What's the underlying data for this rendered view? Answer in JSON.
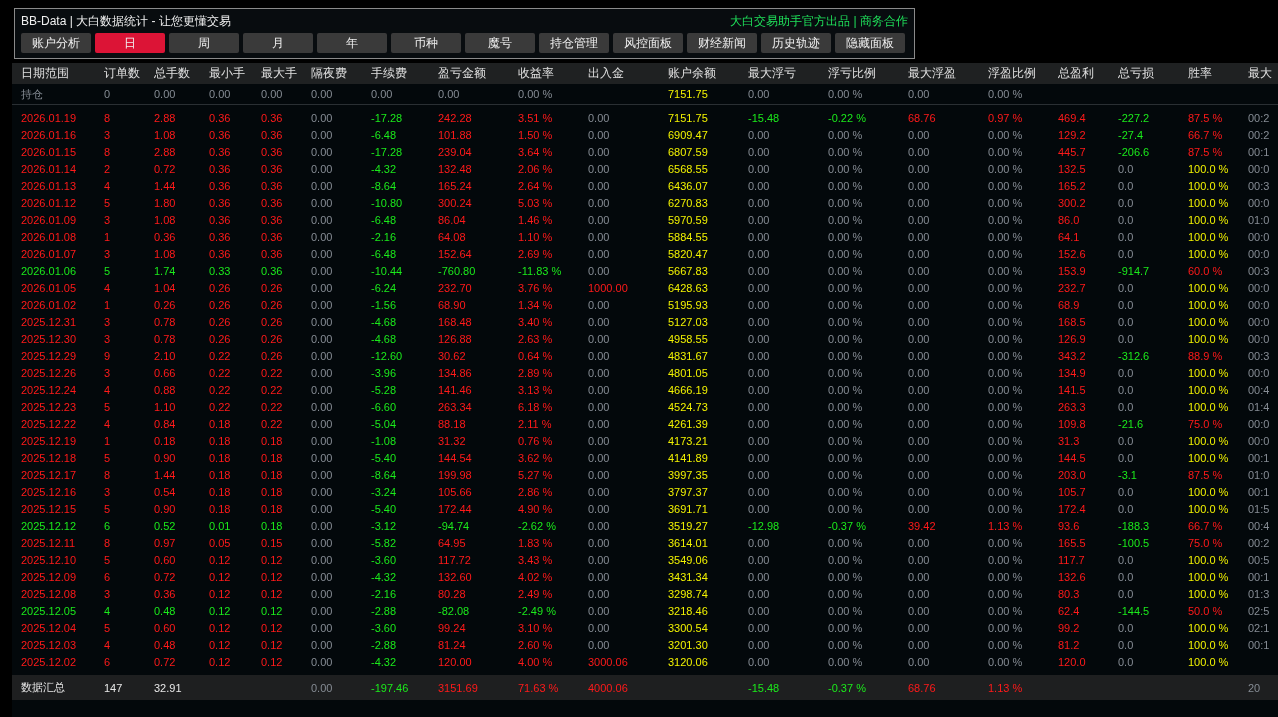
{
  "panel": {
    "title": "BB-Data | 大白数据统计 - 让您更懂交易",
    "credit": "大白交易助手官方出品 | 商务合作"
  },
  "buttons": [
    {
      "label": "账户分析",
      "selected": false
    },
    {
      "label": "日",
      "selected": true
    },
    {
      "label": "周",
      "selected": false
    },
    {
      "label": "月",
      "selected": false
    },
    {
      "label": "年",
      "selected": false
    },
    {
      "label": "币种",
      "selected": false
    },
    {
      "label": "魔号",
      "selected": false
    },
    {
      "label": "持仓管理",
      "selected": false
    },
    {
      "label": "风控面板",
      "selected": false
    },
    {
      "label": "财经新闻",
      "selected": false
    },
    {
      "label": "历史轨迹",
      "selected": false
    },
    {
      "label": "隐藏面板",
      "selected": false
    }
  ],
  "table": {
    "columns": [
      "日期范围",
      "订单数",
      "总手数",
      "最小手",
      "最大手",
      "隔夜费",
      "手续费",
      "盈亏金额",
      "收益率",
      "出入金",
      "账户余额",
      "最大浮亏",
      "浮亏比例",
      "最大浮盈",
      "浮盈比例",
      "总盈利",
      "总亏损",
      "胜率",
      "最大"
    ],
    "hold_row": {
      "cells": [
        "持仓",
        "0",
        "0.00",
        "0.00",
        "0.00",
        "0.00",
        "0.00",
        "0.00",
        "0.00 %",
        null,
        "7151.75",
        "0.00",
        "0.00 %",
        "0.00",
        "0.00 %",
        null,
        null,
        null,
        null
      ]
    },
    "rows": [
      {
        "loss": false,
        "deposit": false,
        "floating": true,
        "had_loss": true,
        "all_won": false,
        "cells": [
          "2026.01.19",
          "8",
          "2.88",
          "0.36",
          "0.36",
          "0.00",
          "-17.28",
          "242.28",
          "3.51 %",
          "0.00",
          "7151.75",
          "-15.48",
          "-0.22 %",
          "68.76",
          "0.97 %",
          "469.4",
          "-227.2",
          "87.5 %",
          "00:2"
        ]
      },
      {
        "loss": false,
        "deposit": false,
        "floating": false,
        "had_loss": true,
        "all_won": false,
        "cells": [
          "2026.01.16",
          "3",
          "1.08",
          "0.36",
          "0.36",
          "0.00",
          "-6.48",
          "101.88",
          "1.50 %",
          "0.00",
          "6909.47",
          "0.00",
          "0.00 %",
          "0.00",
          "0.00 %",
          "129.2",
          "-27.4",
          "66.7 %",
          "00:2"
        ]
      },
      {
        "loss": false,
        "deposit": false,
        "floating": false,
        "had_loss": true,
        "all_won": false,
        "cells": [
          "2026.01.15",
          "8",
          "2.88",
          "0.36",
          "0.36",
          "0.00",
          "-17.28",
          "239.04",
          "3.64 %",
          "0.00",
          "6807.59",
          "0.00",
          "0.00 %",
          "0.00",
          "0.00 %",
          "445.7",
          "-206.6",
          "87.5 %",
          "00:1"
        ]
      },
      {
        "loss": false,
        "deposit": false,
        "floating": false,
        "had_loss": false,
        "all_won": true,
        "cells": [
          "2026.01.14",
          "2",
          "0.72",
          "0.36",
          "0.36",
          "0.00",
          "-4.32",
          "132.48",
          "2.06 %",
          "0.00",
          "6568.55",
          "0.00",
          "0.00 %",
          "0.00",
          "0.00 %",
          "132.5",
          "0.0",
          "100.0 %",
          "00:0"
        ]
      },
      {
        "loss": false,
        "deposit": false,
        "floating": false,
        "had_loss": false,
        "all_won": true,
        "cells": [
          "2026.01.13",
          "4",
          "1.44",
          "0.36",
          "0.36",
          "0.00",
          "-8.64",
          "165.24",
          "2.64 %",
          "0.00",
          "6436.07",
          "0.00",
          "0.00 %",
          "0.00",
          "0.00 %",
          "165.2",
          "0.0",
          "100.0 %",
          "00:3"
        ]
      },
      {
        "loss": false,
        "deposit": false,
        "floating": false,
        "had_loss": false,
        "all_won": true,
        "cells": [
          "2026.01.12",
          "5",
          "1.80",
          "0.36",
          "0.36",
          "0.00",
          "-10.80",
          "300.24",
          "5.03 %",
          "0.00",
          "6270.83",
          "0.00",
          "0.00 %",
          "0.00",
          "0.00 %",
          "300.2",
          "0.0",
          "100.0 %",
          "00:0"
        ]
      },
      {
        "loss": false,
        "deposit": false,
        "floating": false,
        "had_loss": false,
        "all_won": true,
        "cells": [
          "2026.01.09",
          "3",
          "1.08",
          "0.36",
          "0.36",
          "0.00",
          "-6.48",
          "86.04",
          "1.46 %",
          "0.00",
          "5970.59",
          "0.00",
          "0.00 %",
          "0.00",
          "0.00 %",
          "86.0",
          "0.0",
          "100.0 %",
          "01:0"
        ]
      },
      {
        "loss": false,
        "deposit": false,
        "floating": false,
        "had_loss": false,
        "all_won": true,
        "cells": [
          "2026.01.08",
          "1",
          "0.36",
          "0.36",
          "0.36",
          "0.00",
          "-2.16",
          "64.08",
          "1.10 %",
          "0.00",
          "5884.55",
          "0.00",
          "0.00 %",
          "0.00",
          "0.00 %",
          "64.1",
          "0.0",
          "100.0 %",
          "00:0"
        ]
      },
      {
        "loss": false,
        "deposit": false,
        "floating": false,
        "had_loss": false,
        "all_won": true,
        "cells": [
          "2026.01.07",
          "3",
          "1.08",
          "0.36",
          "0.36",
          "0.00",
          "-6.48",
          "152.64",
          "2.69 %",
          "0.00",
          "5820.47",
          "0.00",
          "0.00 %",
          "0.00",
          "0.00 %",
          "152.6",
          "0.0",
          "100.0 %",
          "00:0"
        ]
      },
      {
        "loss": true,
        "deposit": false,
        "floating": false,
        "had_loss": true,
        "all_won": false,
        "cells": [
          "2026.01.06",
          "5",
          "1.74",
          "0.33",
          "0.36",
          "0.00",
          "-10.44",
          "-760.80",
          "-11.83 %",
          "0.00",
          "5667.83",
          "0.00",
          "0.00 %",
          "0.00",
          "0.00 %",
          "153.9",
          "-914.7",
          "60.0 %",
          "00:3"
        ]
      },
      {
        "loss": false,
        "deposit": true,
        "floating": false,
        "had_loss": false,
        "all_won": true,
        "cells": [
          "2026.01.05",
          "4",
          "1.04",
          "0.26",
          "0.26",
          "0.00",
          "-6.24",
          "232.70",
          "3.76 %",
          "1000.00",
          "6428.63",
          "0.00",
          "0.00 %",
          "0.00",
          "0.00 %",
          "232.7",
          "0.0",
          "100.0 %",
          "00:0"
        ]
      },
      {
        "loss": false,
        "deposit": false,
        "floating": false,
        "had_loss": false,
        "all_won": true,
        "cells": [
          "2026.01.02",
          "1",
          "0.26",
          "0.26",
          "0.26",
          "0.00",
          "-1.56",
          "68.90",
          "1.34 %",
          "0.00",
          "5195.93",
          "0.00",
          "0.00 %",
          "0.00",
          "0.00 %",
          "68.9",
          "0.0",
          "100.0 %",
          "00:0"
        ]
      },
      {
        "loss": false,
        "deposit": false,
        "floating": false,
        "had_loss": false,
        "all_won": true,
        "cells": [
          "2025.12.31",
          "3",
          "0.78",
          "0.26",
          "0.26",
          "0.00",
          "-4.68",
          "168.48",
          "3.40 %",
          "0.00",
          "5127.03",
          "0.00",
          "0.00 %",
          "0.00",
          "0.00 %",
          "168.5",
          "0.0",
          "100.0 %",
          "00:0"
        ]
      },
      {
        "loss": false,
        "deposit": false,
        "floating": false,
        "had_loss": false,
        "all_won": true,
        "cells": [
          "2025.12.30",
          "3",
          "0.78",
          "0.26",
          "0.26",
          "0.00",
          "-4.68",
          "126.88",
          "2.63 %",
          "0.00",
          "4958.55",
          "0.00",
          "0.00 %",
          "0.00",
          "0.00 %",
          "126.9",
          "0.0",
          "100.0 %",
          "00:0"
        ]
      },
      {
        "loss": false,
        "deposit": false,
        "floating": false,
        "had_loss": true,
        "all_won": false,
        "cells": [
          "2025.12.29",
          "9",
          "2.10",
          "0.22",
          "0.26",
          "0.00",
          "-12.60",
          "30.62",
          "0.64 %",
          "0.00",
          "4831.67",
          "0.00",
          "0.00 %",
          "0.00",
          "0.00 %",
          "343.2",
          "-312.6",
          "88.9 %",
          "00:3"
        ]
      },
      {
        "loss": false,
        "deposit": false,
        "floating": false,
        "had_loss": false,
        "all_won": true,
        "cells": [
          "2025.12.26",
          "3",
          "0.66",
          "0.22",
          "0.22",
          "0.00",
          "-3.96",
          "134.86",
          "2.89 %",
          "0.00",
          "4801.05",
          "0.00",
          "0.00 %",
          "0.00",
          "0.00 %",
          "134.9",
          "0.0",
          "100.0 %",
          "00:0"
        ]
      },
      {
        "loss": false,
        "deposit": false,
        "floating": false,
        "had_loss": false,
        "all_won": true,
        "cells": [
          "2025.12.24",
          "4",
          "0.88",
          "0.22",
          "0.22",
          "0.00",
          "-5.28",
          "141.46",
          "3.13 %",
          "0.00",
          "4666.19",
          "0.00",
          "0.00 %",
          "0.00",
          "0.00 %",
          "141.5",
          "0.0",
          "100.0 %",
          "00:4"
        ]
      },
      {
        "loss": false,
        "deposit": false,
        "floating": false,
        "had_loss": false,
        "all_won": true,
        "cells": [
          "2025.12.23",
          "5",
          "1.10",
          "0.22",
          "0.22",
          "0.00",
          "-6.60",
          "263.34",
          "6.18 %",
          "0.00",
          "4524.73",
          "0.00",
          "0.00 %",
          "0.00",
          "0.00 %",
          "263.3",
          "0.0",
          "100.0 %",
          "01:4"
        ]
      },
      {
        "loss": false,
        "deposit": false,
        "floating": false,
        "had_loss": true,
        "all_won": false,
        "cells": [
          "2025.12.22",
          "4",
          "0.84",
          "0.18",
          "0.22",
          "0.00",
          "-5.04",
          "88.18",
          "2.11 %",
          "0.00",
          "4261.39",
          "0.00",
          "0.00 %",
          "0.00",
          "0.00 %",
          "109.8",
          "-21.6",
          "75.0 %",
          "00:0"
        ]
      },
      {
        "loss": false,
        "deposit": false,
        "floating": false,
        "had_loss": false,
        "all_won": true,
        "cells": [
          "2025.12.19",
          "1",
          "0.18",
          "0.18",
          "0.18",
          "0.00",
          "-1.08",
          "31.32",
          "0.76 %",
          "0.00",
          "4173.21",
          "0.00",
          "0.00 %",
          "0.00",
          "0.00 %",
          "31.3",
          "0.0",
          "100.0 %",
          "00:0"
        ]
      },
      {
        "loss": false,
        "deposit": false,
        "floating": false,
        "had_loss": false,
        "all_won": true,
        "cells": [
          "2025.12.18",
          "5",
          "0.90",
          "0.18",
          "0.18",
          "0.00",
          "-5.40",
          "144.54",
          "3.62 %",
          "0.00",
          "4141.89",
          "0.00",
          "0.00 %",
          "0.00",
          "0.00 %",
          "144.5",
          "0.0",
          "100.0 %",
          "00:1"
        ]
      },
      {
        "loss": false,
        "deposit": false,
        "floating": false,
        "had_loss": true,
        "all_won": false,
        "cells": [
          "2025.12.17",
          "8",
          "1.44",
          "0.18",
          "0.18",
          "0.00",
          "-8.64",
          "199.98",
          "5.27 %",
          "0.00",
          "3997.35",
          "0.00",
          "0.00 %",
          "0.00",
          "0.00 %",
          "203.0",
          "-3.1",
          "87.5 %",
          "01:0"
        ]
      },
      {
        "loss": false,
        "deposit": false,
        "floating": false,
        "had_loss": false,
        "all_won": true,
        "cells": [
          "2025.12.16",
          "3",
          "0.54",
          "0.18",
          "0.18",
          "0.00",
          "-3.24",
          "105.66",
          "2.86 %",
          "0.00",
          "3797.37",
          "0.00",
          "0.00 %",
          "0.00",
          "0.00 %",
          "105.7",
          "0.0",
          "100.0 %",
          "00:1"
        ]
      },
      {
        "loss": false,
        "deposit": false,
        "floating": false,
        "had_loss": false,
        "all_won": true,
        "cells": [
          "2025.12.15",
          "5",
          "0.90",
          "0.18",
          "0.18",
          "0.00",
          "-5.40",
          "172.44",
          "4.90 %",
          "0.00",
          "3691.71",
          "0.00",
          "0.00 %",
          "0.00",
          "0.00 %",
          "172.4",
          "0.0",
          "100.0 %",
          "01:5"
        ]
      },
      {
        "loss": true,
        "deposit": false,
        "floating": true,
        "had_loss": true,
        "all_won": false,
        "cells": [
          "2025.12.12",
          "6",
          "0.52",
          "0.01",
          "0.18",
          "0.00",
          "-3.12",
          "-94.74",
          "-2.62 %",
          "0.00",
          "3519.27",
          "-12.98",
          "-0.37 %",
          "39.42",
          "1.13 %",
          "93.6",
          "-188.3",
          "66.7 %",
          "00:4"
        ]
      },
      {
        "loss": false,
        "deposit": false,
        "floating": false,
        "had_loss": true,
        "all_won": false,
        "cells": [
          "2025.12.11",
          "8",
          "0.97",
          "0.05",
          "0.15",
          "0.00",
          "-5.82",
          "64.95",
          "1.83 %",
          "0.00",
          "3614.01",
          "0.00",
          "0.00 %",
          "0.00",
          "0.00 %",
          "165.5",
          "-100.5",
          "75.0 %",
          "00:2"
        ]
      },
      {
        "loss": false,
        "deposit": false,
        "floating": false,
        "had_loss": false,
        "all_won": true,
        "cells": [
          "2025.12.10",
          "5",
          "0.60",
          "0.12",
          "0.12",
          "0.00",
          "-3.60",
          "117.72",
          "3.43 %",
          "0.00",
          "3549.06",
          "0.00",
          "0.00 %",
          "0.00",
          "0.00 %",
          "117.7",
          "0.0",
          "100.0 %",
          "00:5"
        ]
      },
      {
        "loss": false,
        "deposit": false,
        "floating": false,
        "had_loss": false,
        "all_won": true,
        "cells": [
          "2025.12.09",
          "6",
          "0.72",
          "0.12",
          "0.12",
          "0.00",
          "-4.32",
          "132.60",
          "4.02 %",
          "0.00",
          "3431.34",
          "0.00",
          "0.00 %",
          "0.00",
          "0.00 %",
          "132.6",
          "0.0",
          "100.0 %",
          "00:1"
        ]
      },
      {
        "loss": false,
        "deposit": false,
        "floating": false,
        "had_loss": false,
        "all_won": true,
        "cells": [
          "2025.12.08",
          "3",
          "0.36",
          "0.12",
          "0.12",
          "0.00",
          "-2.16",
          "80.28",
          "2.49 %",
          "0.00",
          "3298.74",
          "0.00",
          "0.00 %",
          "0.00",
          "0.00 %",
          "80.3",
          "0.0",
          "100.0 %",
          "01:3"
        ]
      },
      {
        "loss": true,
        "deposit": false,
        "floating": false,
        "had_loss": true,
        "all_won": false,
        "cells": [
          "2025.12.05",
          "4",
          "0.48",
          "0.12",
          "0.12",
          "0.00",
          "-2.88",
          "-82.08",
          "-2.49 %",
          "0.00",
          "3218.46",
          "0.00",
          "0.00 %",
          "0.00",
          "0.00 %",
          "62.4",
          "-144.5",
          "50.0 %",
          "02:5"
        ]
      },
      {
        "loss": false,
        "deposit": false,
        "floating": false,
        "had_loss": false,
        "all_won": true,
        "cells": [
          "2025.12.04",
          "5",
          "0.60",
          "0.12",
          "0.12",
          "0.00",
          "-3.60",
          "99.24",
          "3.10 %",
          "0.00",
          "3300.54",
          "0.00",
          "0.00 %",
          "0.00",
          "0.00 %",
          "99.2",
          "0.0",
          "100.0 %",
          "02:1"
        ]
      },
      {
        "loss": false,
        "deposit": false,
        "floating": false,
        "had_loss": false,
        "all_won": true,
        "cells": [
          "2025.12.03",
          "4",
          "0.48",
          "0.12",
          "0.12",
          "0.00",
          "-2.88",
          "81.24",
          "2.60 %",
          "0.00",
          "3201.30",
          "0.00",
          "0.00 %",
          "0.00",
          "0.00 %",
          "81.2",
          "0.0",
          "100.0 %",
          "00:1"
        ]
      },
      {
        "loss": false,
        "deposit": true,
        "floating": false,
        "had_loss": false,
        "all_won": true,
        "cells": [
          "2025.12.02",
          "6",
          "0.72",
          "0.12",
          "0.12",
          "0.00",
          "-4.32",
          "120.00",
          "4.00 %",
          "3000.06",
          "3120.06",
          "0.00",
          "0.00 %",
          "0.00",
          "0.00 %",
          "120.0",
          "0.0",
          "100.0 %",
          null
        ]
      }
    ],
    "summary": {
      "cells": [
        "数据汇总",
        "147",
        "32.91",
        null,
        null,
        "0.00",
        "-197.46",
        "3151.69",
        "71.63 %",
        "4000.06",
        null,
        "-15.48",
        "-0.37 %",
        "68.76",
        "1.13 %",
        null,
        null,
        null,
        "20"
      ]
    }
  }
}
